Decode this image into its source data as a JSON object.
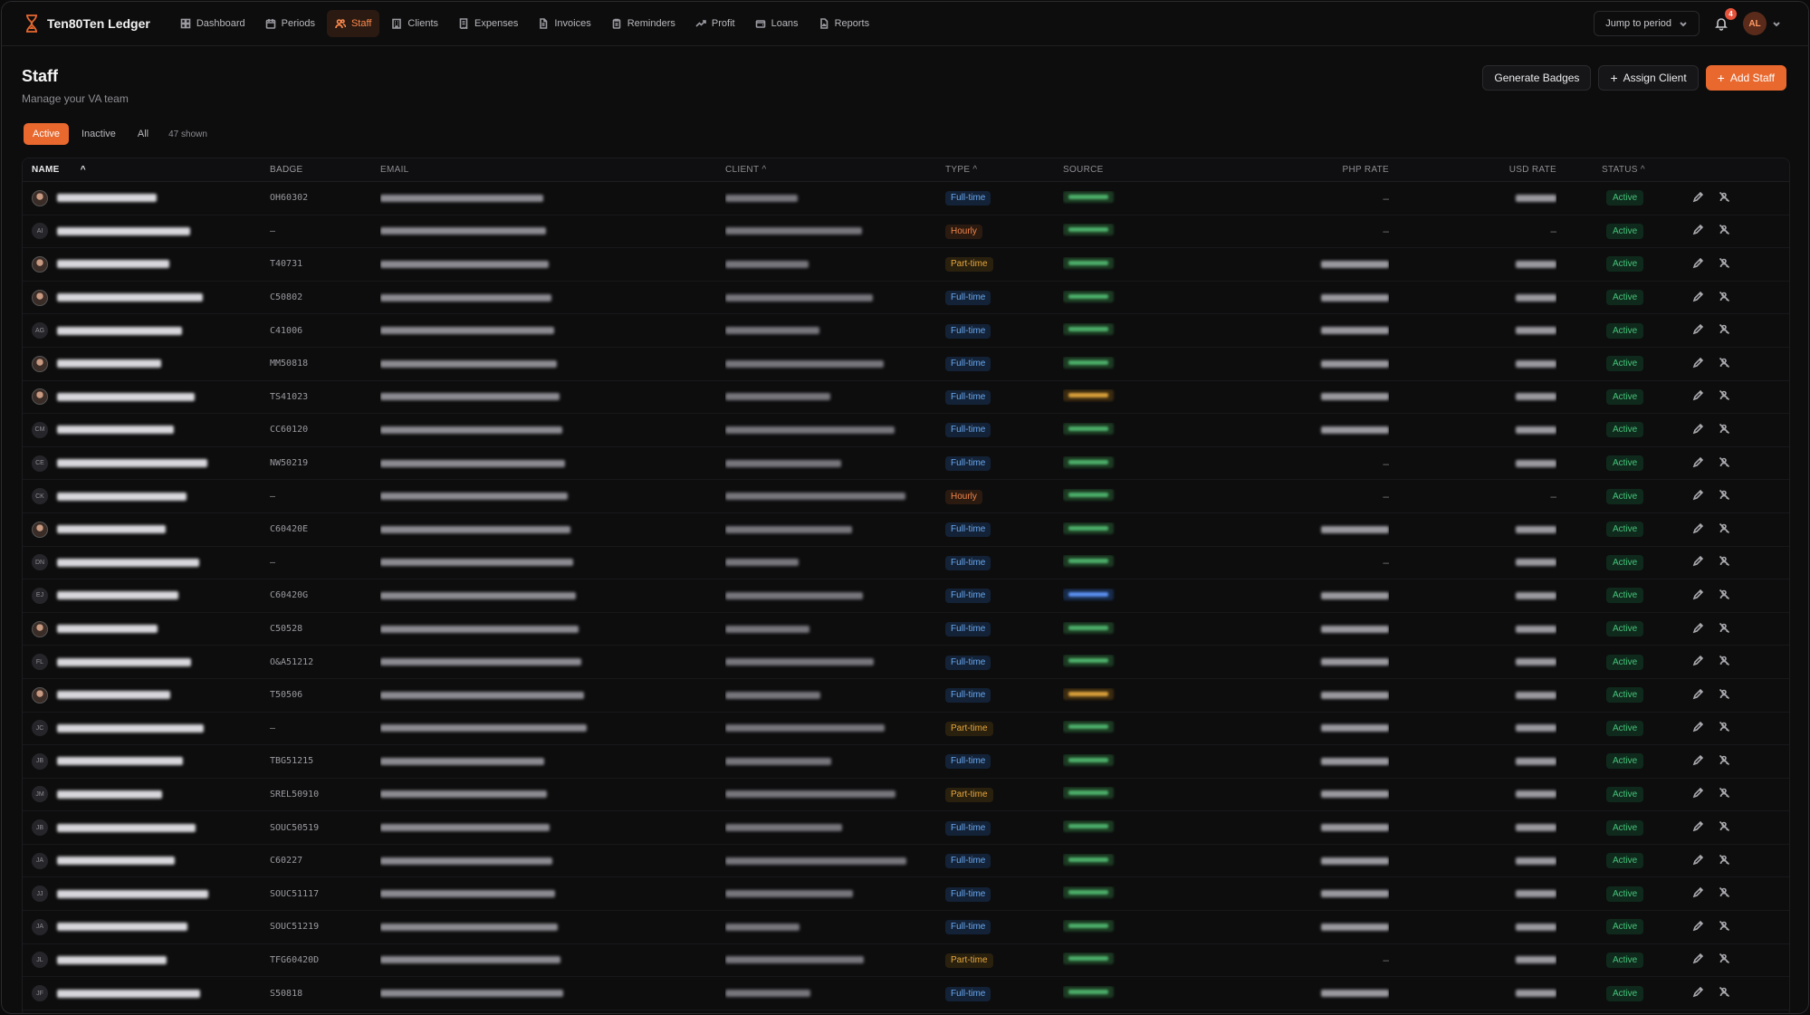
{
  "app": {
    "name": "Ten80Ten Ledger"
  },
  "nav": [
    {
      "label": "Dashboard",
      "icon": "grid-icon",
      "active": false
    },
    {
      "label": "Periods",
      "icon": "calendar-icon",
      "active": false
    },
    {
      "label": "Staff",
      "icon": "users-icon",
      "active": true
    },
    {
      "label": "Clients",
      "icon": "building-icon",
      "active": false
    },
    {
      "label": "Expenses",
      "icon": "receipt-icon",
      "active": false
    },
    {
      "label": "Invoices",
      "icon": "file-icon",
      "active": false
    },
    {
      "label": "Reminders",
      "icon": "clipboard-icon",
      "active": false
    },
    {
      "label": "Profit",
      "icon": "trending-up-icon",
      "active": false
    },
    {
      "label": "Loans",
      "icon": "wallet-icon",
      "active": false
    },
    {
      "label": "Reports",
      "icon": "report-icon",
      "active": false
    }
  ],
  "topbar": {
    "jump_label": "Jump to period",
    "notification_count": "4",
    "user_initials": "AL"
  },
  "header": {
    "title": "Staff",
    "subtitle": "Manage your VA team"
  },
  "actions": {
    "generate_badges": "Generate Badges",
    "assign_client": "Assign Client",
    "add_staff": "Add Staff"
  },
  "filters": {
    "tabs": [
      "Active",
      "Inactive",
      "All"
    ],
    "active_tab": "Active",
    "count_label": "47 shown"
  },
  "table": {
    "columns": {
      "name": "NAME",
      "badge": "BADGE",
      "email": "EMAIL",
      "client": "CLIENT",
      "type": "TYPE",
      "source": "SOURCE",
      "php_rate": "PHP RATE",
      "usd_rate": "USD RATE",
      "status": "STATUS"
    },
    "rows": [
      {
        "initials": "",
        "photo": true,
        "badge": "OH60302",
        "type": "Full-time",
        "source": "imported",
        "has_php": false,
        "has_usd": true,
        "status": "Active"
      },
      {
        "initials": "AI",
        "photo": false,
        "badge": "–",
        "type": "Hourly",
        "source": "imported",
        "has_php": false,
        "has_usd": false,
        "status": "Active"
      },
      {
        "initials": "",
        "photo": true,
        "badge": "T40731",
        "type": "Part-time",
        "source": "imported",
        "has_php": true,
        "has_usd": true,
        "status": "Active"
      },
      {
        "initials": "",
        "photo": true,
        "badge": "C50802",
        "type": "Full-time",
        "source": "imported",
        "has_php": true,
        "has_usd": true,
        "status": "Active"
      },
      {
        "initials": "AG",
        "photo": false,
        "badge": "C41006",
        "type": "Full-time",
        "source": "imported",
        "has_php": true,
        "has_usd": true,
        "status": "Active"
      },
      {
        "initials": "",
        "photo": true,
        "badge": "MM50818",
        "type": "Full-time",
        "source": "imported",
        "has_php": true,
        "has_usd": true,
        "status": "Active"
      },
      {
        "initials": "",
        "photo": true,
        "badge": "TS41023",
        "type": "Full-time",
        "source": "manual",
        "has_php": true,
        "has_usd": true,
        "status": "Active"
      },
      {
        "initials": "CM",
        "photo": false,
        "badge": "CC60120",
        "type": "Full-time",
        "source": "imported",
        "has_php": true,
        "has_usd": true,
        "status": "Active"
      },
      {
        "initials": "CE",
        "photo": false,
        "badge": "NW50219",
        "type": "Full-time",
        "source": "imported",
        "has_php": false,
        "has_usd": true,
        "status": "Active"
      },
      {
        "initials": "CK",
        "photo": false,
        "badge": "–",
        "type": "Hourly",
        "source": "imported",
        "has_php": false,
        "has_usd": false,
        "status": "Active"
      },
      {
        "initials": "",
        "photo": true,
        "badge": "C60420E",
        "type": "Full-time",
        "source": "imported",
        "has_php": true,
        "has_usd": true,
        "status": "Active"
      },
      {
        "initials": "DN",
        "photo": false,
        "badge": "–",
        "type": "Full-time",
        "source": "imported",
        "has_php": false,
        "has_usd": true,
        "status": "Active"
      },
      {
        "initials": "EJ",
        "photo": false,
        "badge": "C60420G",
        "type": "Full-time",
        "source": "other",
        "has_php": true,
        "has_usd": true,
        "status": "Active"
      },
      {
        "initials": "",
        "photo": true,
        "badge": "C50528",
        "type": "Full-time",
        "source": "imported",
        "has_php": true,
        "has_usd": true,
        "status": "Active"
      },
      {
        "initials": "FL",
        "photo": false,
        "badge": "O&A51212",
        "type": "Full-time",
        "source": "imported",
        "has_php": true,
        "has_usd": true,
        "status": "Active"
      },
      {
        "initials": "",
        "photo": true,
        "badge": "T50506",
        "type": "Full-time",
        "source": "manual",
        "has_php": true,
        "has_usd": true,
        "status": "Active"
      },
      {
        "initials": "JC",
        "photo": false,
        "badge": "–",
        "type": "Part-time",
        "source": "imported",
        "has_php": true,
        "has_usd": true,
        "status": "Active"
      },
      {
        "initials": "JB",
        "photo": false,
        "badge": "TBG51215",
        "type": "Full-time",
        "source": "imported",
        "has_php": true,
        "has_usd": true,
        "status": "Active"
      },
      {
        "initials": "JM",
        "photo": false,
        "badge": "SREL50910",
        "type": "Part-time",
        "source": "imported",
        "has_php": true,
        "has_usd": true,
        "status": "Active"
      },
      {
        "initials": "JB",
        "photo": false,
        "badge": "SOUC50519",
        "type": "Full-time",
        "source": "imported",
        "has_php": true,
        "has_usd": true,
        "status": "Active"
      },
      {
        "initials": "JA",
        "photo": false,
        "badge": "C60227",
        "type": "Full-time",
        "source": "imported",
        "has_php": true,
        "has_usd": true,
        "status": "Active"
      },
      {
        "initials": "JJ",
        "photo": false,
        "badge": "SOUC51117",
        "type": "Full-time",
        "source": "imported",
        "has_php": true,
        "has_usd": true,
        "status": "Active"
      },
      {
        "initials": "JA",
        "photo": false,
        "badge": "SOUC51219",
        "type": "Full-time",
        "source": "imported",
        "has_php": true,
        "has_usd": true,
        "status": "Active"
      },
      {
        "initials": "JL",
        "photo": false,
        "badge": "TFG60420D",
        "type": "Part-time",
        "source": "imported",
        "has_php": false,
        "has_usd": true,
        "status": "Active"
      },
      {
        "initials": "JF",
        "photo": false,
        "badge": "S50818",
        "type": "Full-time",
        "source": "imported",
        "has_php": true,
        "has_usd": true,
        "status": "Active"
      }
    ]
  },
  "colors": {
    "accent": "#e8682e",
    "status_active": "#46c47a",
    "fulltime": "#6aa8f0",
    "hourly": "#f0864a",
    "parttime": "#e7a83c"
  }
}
